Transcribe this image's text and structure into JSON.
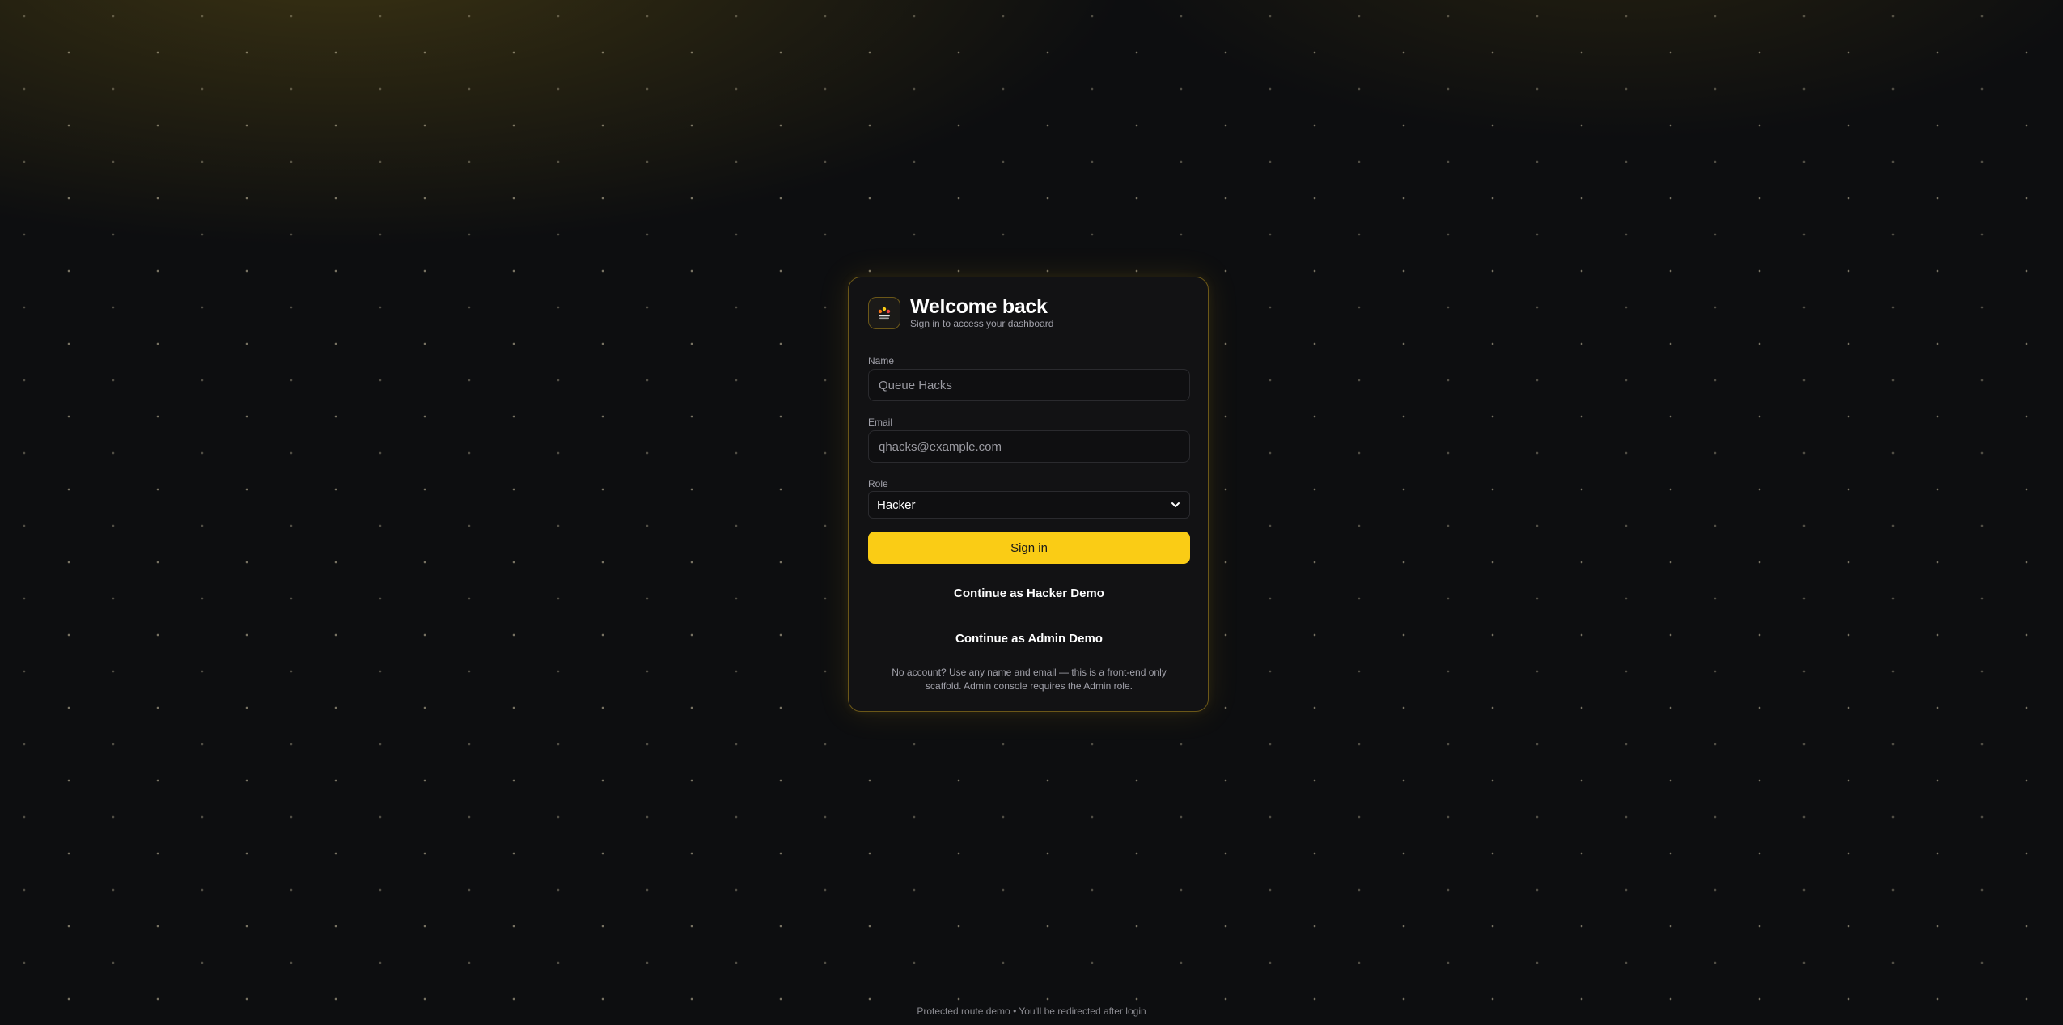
{
  "colors": {
    "accent": "#facc15",
    "background": "#0d0e10",
    "card_border": "#6b5718"
  },
  "logo": {
    "icon": "queue-logo-icon"
  },
  "header": {
    "title": "Welcome back",
    "subtitle": "Sign in to access your dashboard"
  },
  "form": {
    "name": {
      "label": "Name",
      "placeholder": "Queue Hacks",
      "value": ""
    },
    "email": {
      "label": "Email",
      "placeholder": "qhacks@example.com",
      "value": ""
    },
    "role": {
      "label": "Role",
      "selected": "Hacker"
    },
    "sign_in_label": "Sign in",
    "hacker_demo_label": "Continue as Hacker Demo",
    "admin_demo_label": "Continue as Admin Demo",
    "note": "No account? Use any name and email — this is a front-end only scaffold. Admin console requires the Admin role."
  },
  "footer": {
    "text": "Protected route demo • You'll be redirected after login"
  }
}
